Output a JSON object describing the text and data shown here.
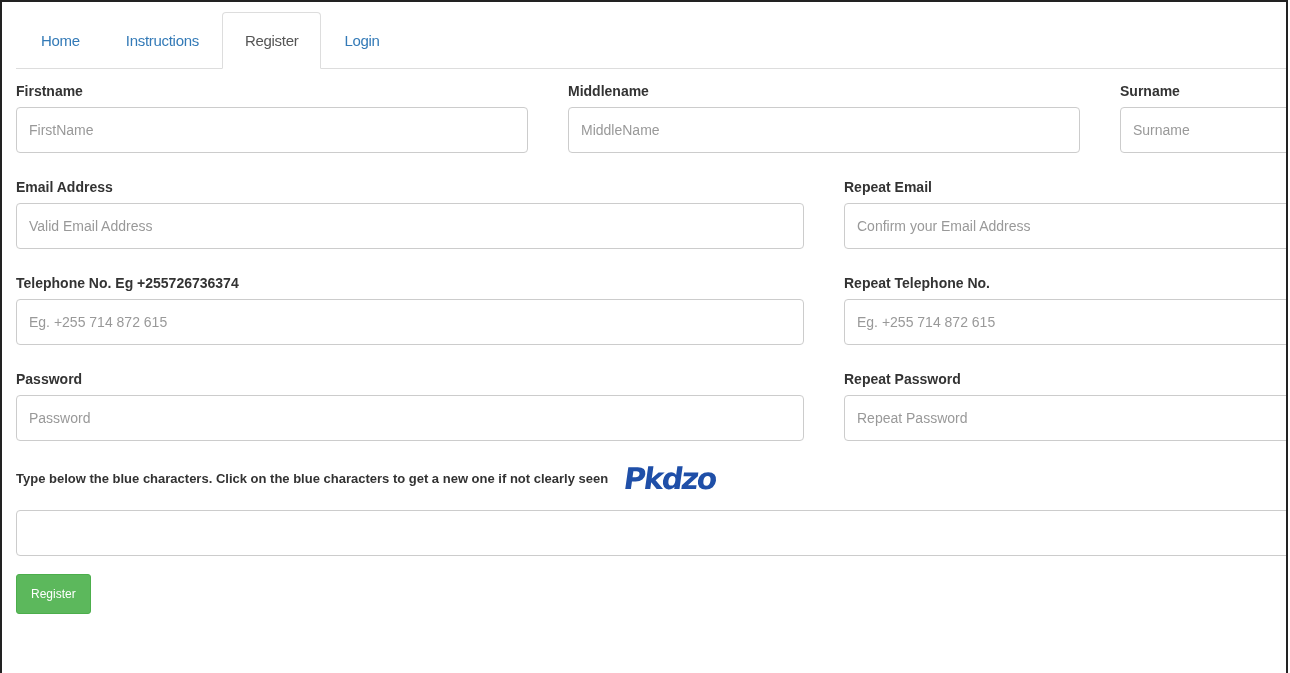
{
  "tabs": [
    {
      "label": "Home",
      "selected": false
    },
    {
      "label": "Instructions",
      "selected": false
    },
    {
      "label": "Register",
      "selected": true
    },
    {
      "label": "Login",
      "selected": false
    }
  ],
  "form_rows": [
    {
      "fields": [
        {
          "label": "Firstname",
          "placeholder": "FirstName"
        },
        {
          "label": "Middlename",
          "placeholder": "MiddleName"
        },
        {
          "label": "Surname",
          "placeholder": "Surname"
        }
      ]
    },
    {
      "fields": [
        {
          "label": "Email Address",
          "placeholder": "Valid Email Address"
        },
        {
          "label": "Repeat Email",
          "placeholder": "Confirm your Email Address"
        }
      ]
    },
    {
      "fields": [
        {
          "label": "Telephone No. Eg +255726736374",
          "placeholder": "Eg. +255 714 872 615"
        },
        {
          "label": "Repeat Telephone No.",
          "placeholder": "Eg. +255 714 872 615"
        }
      ]
    },
    {
      "fields": [
        {
          "label": "Password",
          "placeholder": "Password"
        },
        {
          "label": "Repeat Password",
          "placeholder": "Repeat Password"
        }
      ]
    }
  ],
  "captcha": {
    "instruction": "Type below the blue characters. Click on the blue characters to get a new one if not clearly seen",
    "characters": "Pkdzo"
  },
  "submit_button": "Register"
}
